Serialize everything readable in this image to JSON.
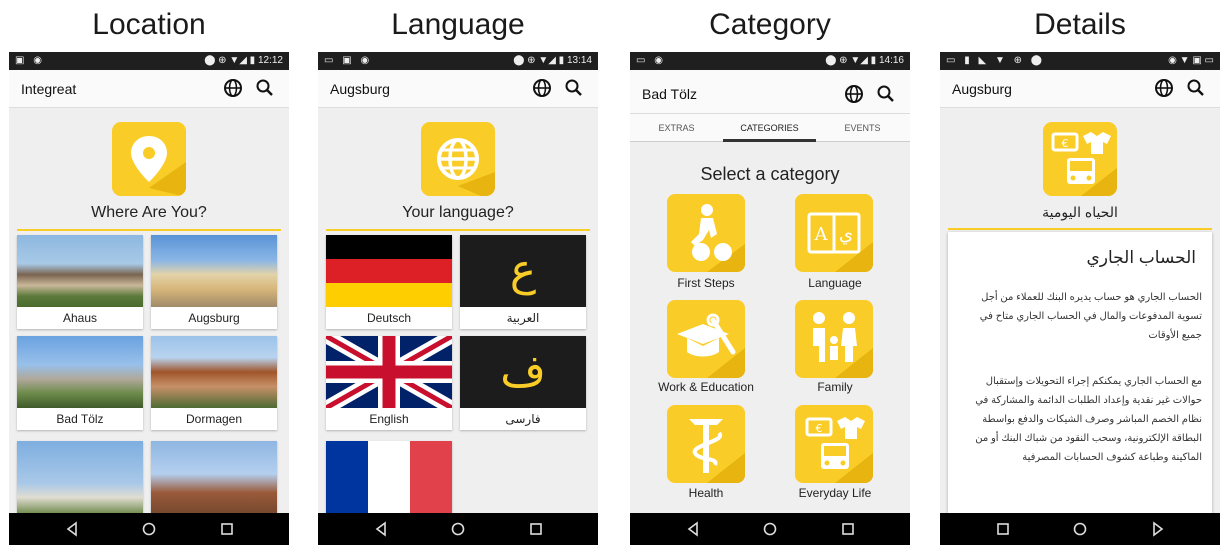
{
  "columns": [
    {
      "heading": "Location"
    },
    {
      "heading": "Language"
    },
    {
      "heading": "Category"
    },
    {
      "heading": "Details"
    }
  ],
  "status": {
    "time1": "12:12",
    "time2": "13:14",
    "time3": "14:16"
  },
  "screen1": {
    "app_title": "Integreat",
    "prompt": "Where Are You?",
    "cities": [
      "Ahaus",
      "Augsburg",
      "Bad Tölz",
      "Dormagen"
    ]
  },
  "screen2": {
    "app_title": "Augsburg",
    "prompt": "Your language?",
    "languages": [
      "Deutsch",
      "العربية",
      "English",
      "فارسی"
    ],
    "glyph_ar": "ع",
    "glyph_fa": "ف"
  },
  "screen3": {
    "app_title": "Bad Tölz",
    "tabs": [
      "EXTRAS",
      "CATEGORIES",
      "EVENTS"
    ],
    "heading": "Select a category",
    "categories": [
      "First Steps",
      "Language",
      "Work & Education",
      "Family",
      "Health",
      "Everyday Life"
    ]
  },
  "screen4": {
    "app_title": "Augsburg",
    "category_label": "الحياه اليومية",
    "title": "الحساب الجاري",
    "para1": "الحساب الجاري هو حساب يديره البنك للعملاء من أجل تسوية المدفوعات والمال في الحساب الجاري متاح في جميع الأوقات",
    "para2": "مع الحساب الجاري يمكنكم إجراء التحويلات وإستقبال حوالات غير نقدية وإعداد الطلبات الدائمة والمشاركة في نظام الخصم المباشر وصرف الشيكات والدفع بواسطة البطاقة الإلكترونية، وسحب النقود من شباك البنك أو من الماكينة وطباعة كشوف الحسابات المصرفية"
  },
  "colors": {
    "accent": "#f9cc28",
    "statusbar": "#1f1f1f",
    "navbar": "#000000"
  }
}
